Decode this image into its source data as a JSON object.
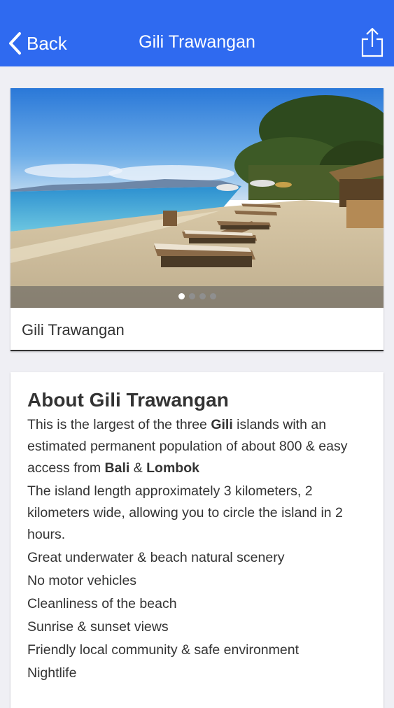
{
  "nav": {
    "back_label": "Back",
    "title": "Gili Trawangan"
  },
  "gallery": {
    "caption": "Gili Trawangan",
    "page_count": 4,
    "active_page": 1
  },
  "about": {
    "title": "About Gili Trawangan",
    "p1": {
      "t1": "This is the largest of the three ",
      "b1": "Gili",
      "t2": " islands with an estimated permanent population of about 800 & easy access from ",
      "b2": "Bali",
      "t3": " & ",
      "b3": "Lombok"
    },
    "p2": "The island length approximately 3 kilometers, 2 kilometers wide, allowing you to circle the island in 2 hours.",
    "features": [
      "Great underwater & beach natural scenery",
      "No motor vehicles",
      "Cleanliness of the beach",
      "Sunrise & sunset views",
      "Friendly local community & safe environment",
      "Nightlife"
    ]
  },
  "colors": {
    "navbar": "#2f6af0",
    "background": "#efeff4"
  }
}
